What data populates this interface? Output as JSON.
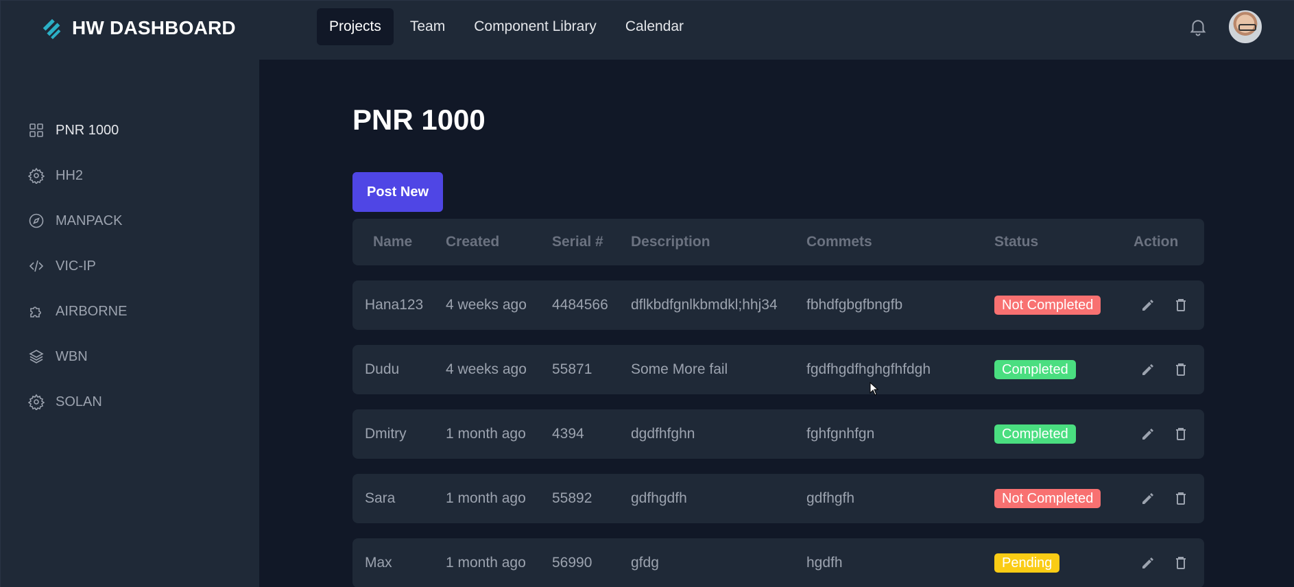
{
  "header": {
    "brand": "HW DASHBOARD",
    "nav": [
      {
        "label": "Projects",
        "active": true
      },
      {
        "label": "Team",
        "active": false
      },
      {
        "label": "Component Library",
        "active": false
      },
      {
        "label": "Calendar",
        "active": false
      }
    ],
    "icons": {
      "logo": "layers-logo-icon",
      "notifications": "bell-icon",
      "avatar": "user-avatar"
    }
  },
  "sidebar": {
    "items": [
      {
        "label": "PNR 1000",
        "icon": "grid-icon",
        "active": true
      },
      {
        "label": "HH2",
        "icon": "gear-icon",
        "active": false
      },
      {
        "label": "MANPACK",
        "icon": "compass-icon",
        "active": false
      },
      {
        "label": "VIC-IP",
        "icon": "code-icon",
        "active": false
      },
      {
        "label": "AIRBORNE",
        "icon": "puzzle-icon",
        "active": false
      },
      {
        "label": "WBN",
        "icon": "layers-icon",
        "active": false
      },
      {
        "label": "SOLAN",
        "icon": "gear-icon",
        "active": false
      }
    ]
  },
  "main": {
    "title": "PNR 1000",
    "post_button": "Post New",
    "columns": [
      "Name",
      "Created",
      "Serial #",
      "Description",
      "Commets",
      "Status",
      "Action"
    ],
    "rows": [
      {
        "name": "Hana123",
        "created": "4 weeks ago",
        "serial": "4484566",
        "description": "dflkbdfgnlkbmdkl;hhj34",
        "comments": "fbhdfgbgfbngfb",
        "status": "Not Completed",
        "status_color": "#f87171"
      },
      {
        "name": "Dudu",
        "created": "4 weeks ago",
        "serial": "55871",
        "description": "Some More fail",
        "comments": "fgdfhgdfhghgfhfdgh",
        "status": "Completed",
        "status_color": "#4ade80"
      },
      {
        "name": "Dmitry",
        "created": "1 month ago",
        "serial": "4394",
        "description": "dgdfhfghn",
        "comments": "fghfgnhfgn",
        "status": "Completed",
        "status_color": "#4ade80"
      },
      {
        "name": "Sara",
        "created": "1 month ago",
        "serial": "55892",
        "description": "gdfhgdfh",
        "comments": "gdfhgfh",
        "status": "Not Completed",
        "status_color": "#f87171"
      },
      {
        "name": "Max",
        "created": "1 month ago",
        "serial": "56990",
        "description": "gfdg",
        "comments": "hgdfh",
        "status": "Pending",
        "status_color": "#facc15"
      }
    ],
    "row_actions": [
      "pencil-icon",
      "trash-icon"
    ]
  },
  "colors": {
    "accent": "#4f46e5",
    "panel": "#1f2937",
    "background": "#111827"
  }
}
